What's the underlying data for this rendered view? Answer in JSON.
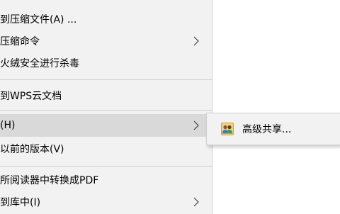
{
  "context_menu": {
    "items": [
      {
        "label": "到压缩文件(A) ...",
        "has_submenu": false
      },
      {
        "label": "压缩命令",
        "has_submenu": true
      },
      {
        "label": "火绒安全进行杀毒",
        "has_submenu": false
      },
      {
        "label": "到WPS云文档",
        "has_submenu": false
      },
      {
        "label": "(H)",
        "has_submenu": true,
        "highlighted": true
      },
      {
        "label": "以前的版本(V)",
        "has_submenu": false
      },
      {
        "label": "所阅读器中转换成PDF",
        "has_submenu": false
      },
      {
        "label": "到库中(I)",
        "has_submenu": true
      }
    ]
  },
  "submenu": {
    "items": [
      {
        "label": "高级共享...",
        "icon": "users-share-icon"
      }
    ]
  },
  "colors": {
    "menu_bg": "#f2f2f2",
    "highlight_bg": "#d9d9d9",
    "separator": "#cfcfcf",
    "text": "#000000"
  }
}
